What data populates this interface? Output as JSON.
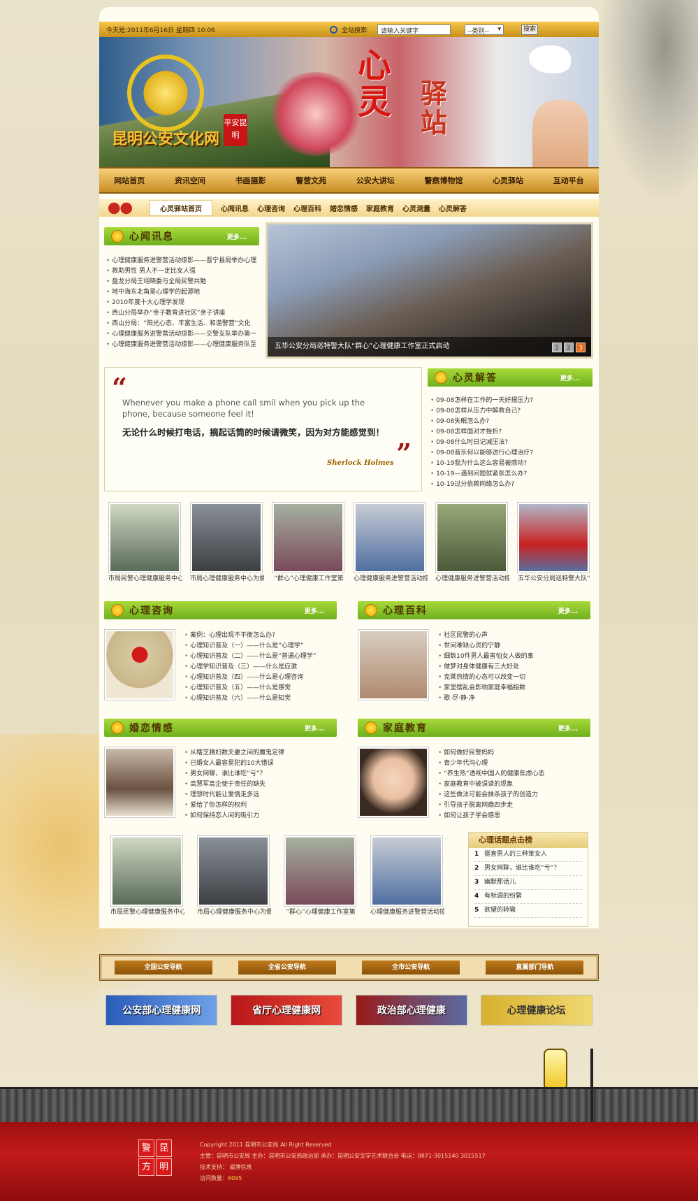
{
  "topbar": {
    "date": "今天是:2011年6月16日 星期四 10:06",
    "search_label": "全站搜索:",
    "search_value": "请输入关键字",
    "category": "--类别--",
    "search_button": "搜索"
  },
  "banner": {
    "site_name": "昆明公安文化网",
    "seal": "平安昆明",
    "title1": "心",
    "title2": "灵",
    "title3": "驿站"
  },
  "nav": [
    "网站首页",
    "资讯空间",
    "书画摄影",
    "警营文苑",
    "公安大讲坛",
    "警察博物馆",
    "心灵驿站",
    "互动平台"
  ],
  "subnav": [
    "心灵驿站首页",
    "心闻讯息",
    "心理咨询",
    "心理百科",
    "婚恋情感",
    "家庭教育",
    "心灵测量",
    "心灵解答"
  ],
  "news": {
    "title": "心闻讯息",
    "more": "更多...",
    "items": [
      "心理健康服务进警营活动掠影——晋宁县局举办心理",
      "救助男性 男人不一定比女人强",
      "盘龙分局王翊晓委与全局民警共勉",
      "地中海东北角是心理学的起源地",
      "2010年度十大心理学发现",
      "西山分局举办“亲子教育进社区”亲子讲座",
      "西山分局：“阳光心态、丰富生活、和谐警营”文化",
      "心理健康服务进警营活动掠影——交警支队举办第一",
      "心理健康服务进警营活动掠影——心理健康服务队至"
    ]
  },
  "slide": {
    "caption": "五华公安分局巡特警大队“群心”心理健康工作室正式启动",
    "pages": [
      "1",
      "2",
      "3"
    ]
  },
  "quote": {
    "open": "“",
    "close": "”",
    "en": "Whenever you make a phone call smil when you pick up the phone, because someone feel it!",
    "cn": "无论什么时候打电话，摘起话筒的时候请微笑，因为对方能感觉到！",
    "sig": "Sherlock Holmes"
  },
  "answers": {
    "title": "心灵解答",
    "more": "更多...",
    "items": [
      "09-08怎样在工作的一天好摆压力?",
      "09-08怎样从压力中解救自己?",
      "09-08失眠怎么办?",
      "09-08怎样面对才挫折?",
      "09-08什么时日记减压法?",
      "09-08音乐何以能够进行心理治疗?",
      "10-19我为什么这么容易被感动?",
      "10-19—遇到问题就紧张怎么办?",
      "10-19过分依赖网络怎么办?"
    ]
  },
  "photos": [
    "市局民警心理健康服务中心",
    "市局心理健康服务中心为便",
    "“群心”心理健康工作室第",
    "心理健康服务进警营活动掠",
    "心理健康服务进警营活动掠",
    "五华公安分局巡特警大队“"
  ],
  "consult": {
    "title": "心理咨询",
    "more": "更多...",
    "items": [
      "案例：心理出现不平衡怎么办?",
      "心理知识普及（一）——什么是“心理学”",
      "心理知识普及（二）——什么是“普通心理学”",
      "心理学知识普及（三）——什么是应激",
      "心理知识普及（四）——什么是心理咨询",
      "心理知识普及（五）——什么是感觉",
      "心理知识普及（六）——什么是知觉"
    ]
  },
  "encyclo": {
    "title": "心理百科",
    "more": "更多...",
    "items": [
      "社区民警的心声",
      "世间难缺心灵的宁静",
      "细数10件男人最害怕女人做的事",
      "做梦对身体健康有三大好处",
      "克莱热情的心态可以改变一切",
      "家里摆乱会影响家庭幸福指数",
      "歌·尽·静·净"
    ]
  },
  "love": {
    "title": "婚恋情感",
    "more": "更多...",
    "items": [
      "从瞎芝猜妇数夫妻之间的魔鬼定律",
      "已婚女人最容易犯的10大错误",
      "男女网聊，谁比谁吃“亏”？",
      "高慧军高企使于责任的缺失",
      "理想时代能让爱情走多远",
      "爱给了你怎样的权利",
      "如何保持恋人间的吸引力"
    ]
  },
  "family": {
    "title": "家庭教育",
    "more": "更多...",
    "items": [
      "如何做好民警妈妈",
      "青少年代沟心理",
      "“养生热”透视中国人的健康焦虑心态",
      "家庭教育中被误读的现象",
      "这些做法可能会抹杀孩子的创造力",
      "引导孩子脱离网瘾四步走",
      "如何让孩子学会感恩"
    ]
  },
  "photos2": [
    "市局民警心理健康服务中心",
    "市局心理健康服务中心为便",
    "“群心”心理健康工作室第",
    "心理健康服务进警营活动掠"
  ],
  "rank": {
    "title": "心理话题点击榜",
    "items": [
      {
        "n": "1",
        "t": "挺喜男人的三种笨女人"
      },
      {
        "n": "2",
        "t": "男女网聊，谁比谁吃“亏”？"
      },
      {
        "n": "3",
        "t": "幽默那话儿"
      },
      {
        "n": "4",
        "t": "有标调的纷繁"
      },
      {
        "n": "5",
        "t": "欲望的转辙"
      }
    ]
  },
  "gnav": [
    "全国公安导航",
    "全省公安导航",
    "全市公安导航",
    "直属部门导航"
  ],
  "links": [
    "公安部心理健康网",
    "省厅心理健康网",
    "政治部心理健康",
    "心理健康论坛"
  ],
  "footer": {
    "logo": [
      "警",
      "昆",
      "方",
      "明"
    ],
    "line1": "Copyright 2011 昆明市公安局 All Right Reserved",
    "line2": "主管：昆明市公安局    主办：昆明市公安局政治部    承办：昆明公安文学艺术联合会    电话：0871-3015140 3015517",
    "line3": "技术支持：  威博信息",
    "line4_label": "访问数量：",
    "line4_count": "6095"
  },
  "colors": {
    "accent": "#c8901a",
    "green": "#7fbf22",
    "footer_red": "#b01616"
  }
}
